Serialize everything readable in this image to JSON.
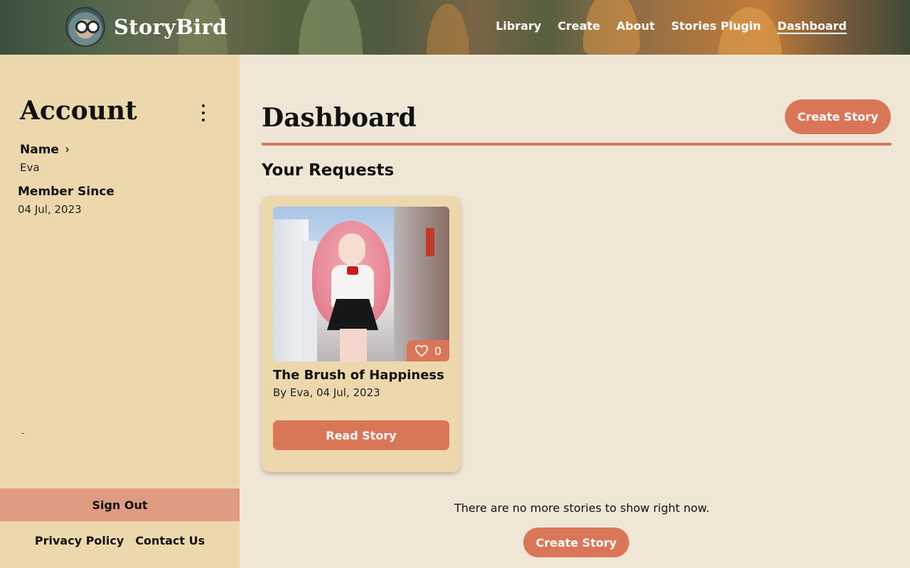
{
  "header": {
    "brand": "StoryBird",
    "logo_icon": "owl-logo-icon",
    "nav": [
      {
        "label": "Library",
        "active": false
      },
      {
        "label": "Create",
        "active": false
      },
      {
        "label": "About",
        "active": false
      },
      {
        "label": "Stories Plugin",
        "active": false
      },
      {
        "label": "Dashboard",
        "active": true
      }
    ]
  },
  "sidebar": {
    "title": "Account",
    "menu_icon": "kebab-menu-icon",
    "name_label": "Name",
    "name_value": "Eva",
    "member_since_label": "Member Since",
    "member_since_value": "04 Jul, 2023",
    "dash": "-",
    "sign_out": "Sign Out",
    "footer_links": [
      "Privacy Policy",
      "Contact Us"
    ]
  },
  "main": {
    "title": "Dashboard",
    "create_button": "Create Story",
    "section_title": "Your Requests",
    "stories": [
      {
        "title": "The Brush of Happiness",
        "meta": "By Eva, 04 Jul, 2023",
        "likes": "0",
        "read_button": "Read Story",
        "image_icon": "story-cover-image"
      }
    ],
    "empty_message": "There are no more stories to show right now.",
    "bottom_button": "Create Story"
  },
  "colors": {
    "accent": "#da7658",
    "sidebar_bg": "#edd8ad",
    "main_bg": "#f0e6d6",
    "signout_bg": "#e09b82"
  }
}
